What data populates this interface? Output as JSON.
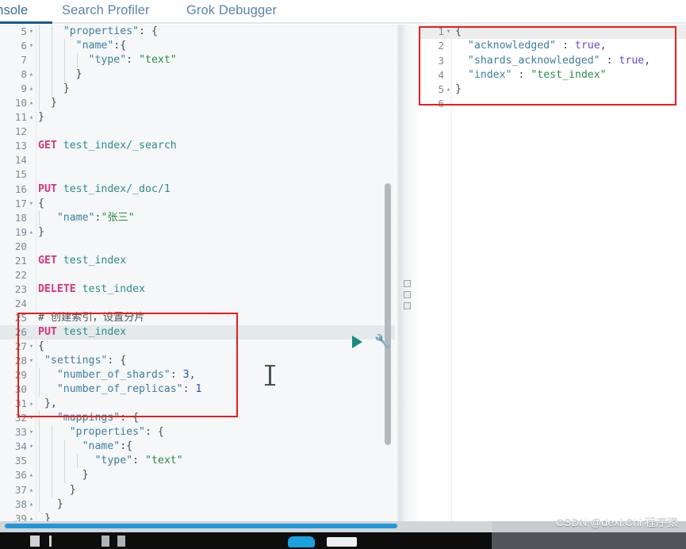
{
  "tabs": [
    {
      "label": "onsole",
      "name": "tab-console",
      "active": true
    },
    {
      "label": "Search Profiler",
      "name": "tab-search-profiler",
      "active": false
    },
    {
      "label": "Grok Debugger",
      "name": "tab-grok-debugger",
      "active": false
    }
  ],
  "editor": {
    "lines": [
      {
        "n": "5",
        "fold": "▾",
        "text": "    \"properties\": {"
      },
      {
        "n": "6",
        "fold": "▾",
        "text": "      \"name\":{"
      },
      {
        "n": "7",
        "fold": "",
        "text": "        \"type\": \"text\""
      },
      {
        "n": "8",
        "fold": "▴",
        "text": "      }"
      },
      {
        "n": "9",
        "fold": "▴",
        "text": "    }"
      },
      {
        "n": "10",
        "fold": "▴",
        "text": "  }"
      },
      {
        "n": "11",
        "fold": "▴",
        "text": "}"
      },
      {
        "n": "12",
        "fold": "",
        "text": ""
      },
      {
        "n": "13",
        "fold": "",
        "text": "GET test_index/_search"
      },
      {
        "n": "14",
        "fold": "",
        "text": ""
      },
      {
        "n": "15",
        "fold": "",
        "text": ""
      },
      {
        "n": "16",
        "fold": "",
        "text": "PUT test_index/_doc/1"
      },
      {
        "n": "17",
        "fold": "▾",
        "text": "{"
      },
      {
        "n": "18",
        "fold": "",
        "text": "   \"name\":\"张三\""
      },
      {
        "n": "19",
        "fold": "▴",
        "text": "}"
      },
      {
        "n": "20",
        "fold": "",
        "text": ""
      },
      {
        "n": "21",
        "fold": "",
        "text": "GET test_index"
      },
      {
        "n": "22",
        "fold": "",
        "text": ""
      },
      {
        "n": "23",
        "fold": "",
        "text": "DELETE test_index"
      },
      {
        "n": "24",
        "fold": "",
        "text": ""
      },
      {
        "n": "25",
        "fold": "",
        "text": "# 创建索引，设置分片"
      },
      {
        "n": "26",
        "fold": "",
        "text": "PUT test_index"
      },
      {
        "n": "27",
        "fold": "▾",
        "text": "{"
      },
      {
        "n": "28",
        "fold": "▾",
        "text": " \"settings\": {"
      },
      {
        "n": "29",
        "fold": "",
        "text": "   \"number_of_shards\": 3,"
      },
      {
        "n": "30",
        "fold": "",
        "text": "   \"number_of_replicas\": 1"
      },
      {
        "n": "31",
        "fold": "▴",
        "text": " },"
      },
      {
        "n": "32",
        "fold": "▾",
        "text": "   \"mappings\": {"
      },
      {
        "n": "33",
        "fold": "▾",
        "text": "     \"properties\": {"
      },
      {
        "n": "34",
        "fold": "▾",
        "text": "       \"name\":{"
      },
      {
        "n": "35",
        "fold": "",
        "text": "         \"type\": \"text\""
      },
      {
        "n": "36",
        "fold": "▴",
        "text": "       }"
      },
      {
        "n": "37",
        "fold": "▴",
        "text": "     }"
      },
      {
        "n": "38",
        "fold": "▴",
        "text": "   }"
      },
      {
        "n": "39",
        "fold": "▴",
        "text": " }"
      }
    ]
  },
  "response": {
    "lines": [
      {
        "n": "1",
        "fold": "▾",
        "text": "{"
      },
      {
        "n": "2",
        "fold": "",
        "text": "  \"acknowledged\" : true,"
      },
      {
        "n": "3",
        "fold": "",
        "text": "  \"shards_acknowledged\" : true,"
      },
      {
        "n": "4",
        "fold": "",
        "text": "  \"index\" : \"test_index\""
      },
      {
        "n": "5",
        "fold": "▴",
        "text": "}"
      },
      {
        "n": "6",
        "fold": "",
        "text": ""
      }
    ]
  },
  "controls": {
    "play_label": "▶",
    "wrench_label": "🔧"
  },
  "watermark": {
    "text": "CSDN @dexi.Chi 程序猿"
  },
  "colors": {
    "accent": "#1b5a8f",
    "annotation": "#ee1b1b",
    "method": "#d6357f",
    "string": "#2a8c4a",
    "key": "#3f7f9f",
    "number": "#2a4fd1",
    "boolean": "#5b4fd6",
    "scrollbar": "#2196d8",
    "play": "#1a8c7a"
  }
}
